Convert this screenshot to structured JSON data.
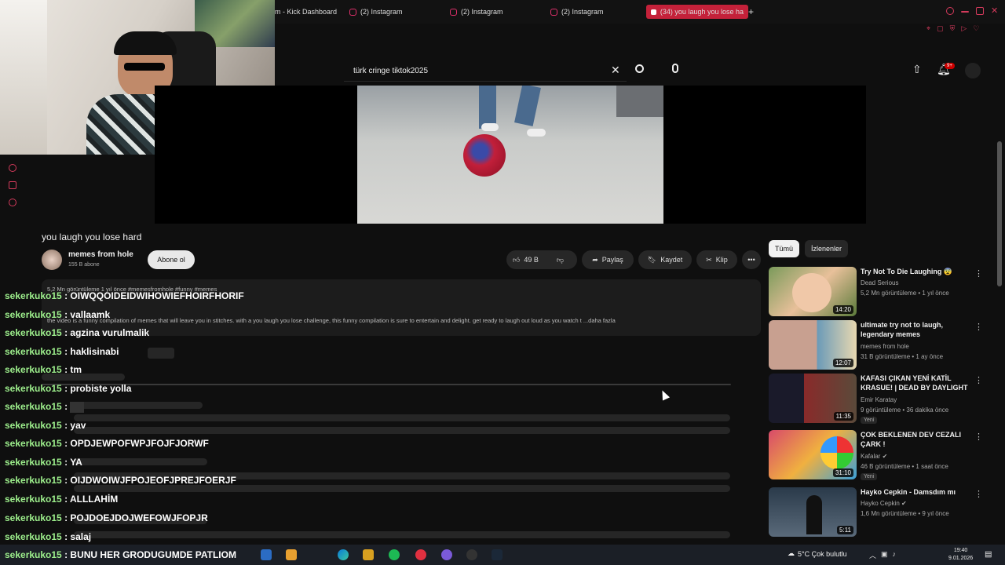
{
  "browser": {
    "tabs": [
      {
        "label": "m - Kick Dashboard",
        "icon": "kick-icon"
      },
      {
        "label": "(2) Instagram",
        "icon": "instagram-icon"
      },
      {
        "label": "(2) Instagram",
        "icon": "instagram-icon"
      },
      {
        "label": "(2) Instagram",
        "icon": "instagram-icon"
      },
      {
        "label": "(34) you laugh you lose ha",
        "icon": "youtube-icon"
      }
    ],
    "new_tab": "+"
  },
  "youtube": {
    "search_value": "türk cringe tiktok2025",
    "notification_count": "9+",
    "video_title": "you laugh you lose hard",
    "channel_name": "memes from hole",
    "subscribers": "155 B abone",
    "subscribe_label": "Abone ol",
    "likes": "49 B",
    "share_label": "Paylaş",
    "save_label": "Kaydet",
    "clip_label": "Klip",
    "views_line": "5,2 Mn görüntüleme  1 yıl önce  #memesfromhole #funny #memes",
    "description": "the video is a funny compilation of memes that will leave you in stitches. with a you laugh you lose challenge, this funny compilation is sure to entertain and delight. get ready to laugh out loud as you watch t ...daha fazla",
    "chips": [
      "Tümü",
      "İzlenenler"
    ],
    "recommendations": [
      {
        "title": "Try Not To Die Laughing 😨",
        "channel": "Dead Serious",
        "meta": "5,2 Mn görüntüleme • 1 yıl önce",
        "duration": "14:20",
        "badge": ""
      },
      {
        "title": "ultimate try not to laugh, legendary memes",
        "channel": "memes from hole",
        "meta": "31 B görüntüleme • 1 ay önce",
        "duration": "12:07",
        "badge": ""
      },
      {
        "title": "KAFASI ÇIKAN YENİ KATİL KRASUE! | DEAD BY DAYLIGHT",
        "channel": "Emir Karatay",
        "meta": "9 görüntüleme • 36 dakika önce",
        "duration": "11:35",
        "badge": "Yeni"
      },
      {
        "title": "ÇOK BEKLENEN DEV CEZALI ÇARK !",
        "channel": "Kafalar",
        "meta": "46 B görüntüleme • 1 saat önce",
        "duration": "31:10",
        "badge": "Yeni"
      },
      {
        "title": "Hayko Cepkin - Damsdım mı",
        "channel": "Hayko Cepkin",
        "meta": "1,6 Mn görüntüleme • 9 yıl önce",
        "duration": "5:11",
        "badge": ""
      }
    ]
  },
  "chat": [
    {
      "user": "sekerkuko15",
      "message": "OIWQQOIDEIDWIHOWIEFHOIRFHORIF"
    },
    {
      "user": "sekerkuko15",
      "message": "vallaamk"
    },
    {
      "user": "sekerkuko15",
      "message": "agzina vurulmalik"
    },
    {
      "user": "sekerkuko15",
      "message": "haklisinabi"
    },
    {
      "user": "sekerkuko15",
      "message": "tm"
    },
    {
      "user": "sekerkuko15",
      "message": "probiste yolla"
    },
    {
      "user": "sekerkuko15",
      "message": ""
    },
    {
      "user": "sekerkuko15",
      "message": "yav"
    },
    {
      "user": "sekerkuko15",
      "message": "OPDJEWPOFWPJFOJFJORWF"
    },
    {
      "user": "sekerkuko15",
      "message": "YA"
    },
    {
      "user": "sekerkuko15",
      "message": "OIJDWOIWJFPOJEOFJPREJFOERJF"
    },
    {
      "user": "sekerkuko15",
      "message": "ALLLAHİM"
    },
    {
      "user": "sekerkuko15",
      "message": "POJDOEJDOJWEFOWJFOPJR"
    },
    {
      "user": "sekerkuko15",
      "message": "salaj"
    },
    {
      "user": "sekerkuko15",
      "message": "BUNU HER GRODUGUMDE PATLIOM"
    }
  ],
  "taskbar": {
    "weather": "5°C  Çok bulutlu",
    "time": "19:40",
    "date": "9.01.2026"
  }
}
